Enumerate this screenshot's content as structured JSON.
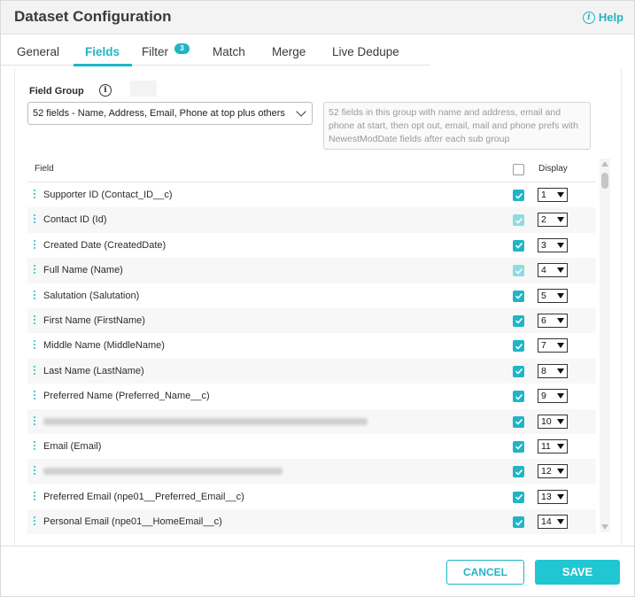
{
  "dialog": {
    "title": "Dataset Configuration",
    "help_label": "Help"
  },
  "tabs": [
    {
      "label": "General"
    },
    {
      "label": "Fields",
      "active": true
    },
    {
      "label": "Filter",
      "badge": "3"
    },
    {
      "label": "Match"
    },
    {
      "label": "Merge"
    },
    {
      "label": "Live Dedupe"
    }
  ],
  "field_group": {
    "label": "Field Group",
    "selected": "52 fields - Name, Address, Email, Phone at top plus others",
    "description": "52 fields in this group with name and address, email and phone at start, then opt out, email, mail and phone prefs with NewestModDate fields after each sub group"
  },
  "table": {
    "col_field": "Field",
    "col_display": "Display",
    "rows": [
      {
        "label": "Supporter ID (Contact_ID__c)",
        "checked": true,
        "display": "1"
      },
      {
        "label": "Contact ID (Id)",
        "checked": true,
        "locked": true,
        "display": "2"
      },
      {
        "label": "Created Date (CreatedDate)",
        "checked": true,
        "display": "3"
      },
      {
        "label": "Full Name (Name)",
        "checked": true,
        "locked": true,
        "display": "4"
      },
      {
        "label": "Salutation (Salutation)",
        "checked": true,
        "display": "5"
      },
      {
        "label": "First Name (FirstName)",
        "checked": true,
        "display": "6"
      },
      {
        "label": "Middle Name (MiddleName)",
        "checked": true,
        "display": "7"
      },
      {
        "label": "Last Name (LastName)",
        "checked": true,
        "display": "8"
      },
      {
        "label": "Preferred Name (Preferred_Name__c)",
        "checked": true,
        "display": "9"
      },
      {
        "label": "",
        "blurred": true,
        "checked": true,
        "display": "10"
      },
      {
        "label": "Email (Email)",
        "checked": true,
        "display": "11"
      },
      {
        "label": "",
        "blurred": true,
        "checked": true,
        "display": "12"
      },
      {
        "label": "Preferred Email (npe01__Preferred_Email__c)",
        "checked": true,
        "display": "13"
      },
      {
        "label": "Personal Email (npe01__HomeEmail__c)",
        "checked": true,
        "display": "14"
      }
    ]
  },
  "footer": {
    "cancel_label": "CANCEL",
    "save_label": "SAVE"
  },
  "colors": {
    "accent": "#20b5c4",
    "save_bg": "#20c6d2",
    "locked_check": "#8fdbe2"
  }
}
